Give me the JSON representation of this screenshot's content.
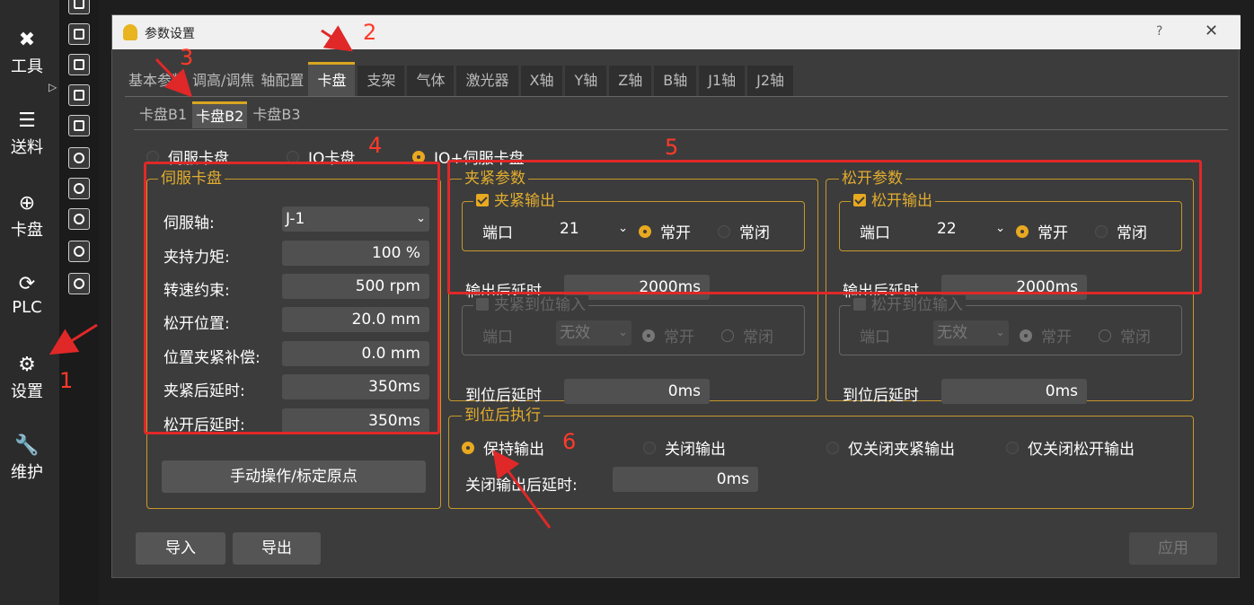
{
  "sidebar": {
    "items": [
      {
        "label": "工具",
        "icon": "tools-icon"
      },
      {
        "label": "送料",
        "icon": "feed-icon"
      },
      {
        "label": "卡盘",
        "icon": "chuck-icon"
      },
      {
        "label": "PLC",
        "icon": "plc-icon"
      },
      {
        "label": "设置",
        "icon": "gear-icon"
      },
      {
        "label": "维护",
        "icon": "wrench-icon"
      }
    ]
  },
  "dialog": {
    "title": "参数设置",
    "help": "?",
    "close": "✕"
  },
  "tabs": [
    "基本参数",
    "调高/调焦",
    "轴配置",
    "卡盘",
    "支架",
    "气体",
    "激光器",
    "X轴",
    "Y轴",
    "Z轴",
    "B轴",
    "J1轴",
    "J2轴"
  ],
  "subtabs": [
    "卡盘B1",
    "卡盘B2",
    "卡盘B3"
  ],
  "chuck_type": {
    "options": [
      "伺服卡盘",
      "IO卡盘",
      "IO+伺服卡盘"
    ],
    "selected": "IO+伺服卡盘"
  },
  "servo": {
    "title": "伺服卡盘",
    "axis_label": "伺服轴:",
    "axis_value": "J-1",
    "torque_label": "夹持力矩:",
    "torque_value": "100 %",
    "speed_label": "转速约束:",
    "speed_value": "500 rpm",
    "release_pos_label": "松开位置:",
    "release_pos_value": "20.0 mm",
    "comp_label": "位置夹紧补偿:",
    "comp_value": "0.0 mm",
    "clamp_delay_label": "夹紧后延时:",
    "clamp_delay_value": "350ms",
    "release_delay_label": "松开后延时:",
    "release_delay_value": "350ms",
    "manual_button": "手动操作/标定原点"
  },
  "clamp": {
    "title": "夹紧参数",
    "output_title": "夹紧输出",
    "port_label": "端口",
    "port_value": "21",
    "no": "常开",
    "nc": "常闭",
    "delay_label": "输出后延时",
    "delay_value": "2000ms",
    "input_title": "夹紧到位输入",
    "input_port_value": "无效",
    "arrive_delay_label": "到位后延时",
    "arrive_delay_value": "0ms"
  },
  "release": {
    "title": "松开参数",
    "output_title": "松开输出",
    "port_label": "端口",
    "port_value": "22",
    "no": "常开",
    "nc": "常闭",
    "delay_label": "输出后延时",
    "delay_value": "2000ms",
    "input_title": "松开到位输入",
    "input_port_value": "无效",
    "arrive_delay_label": "到位后延时",
    "arrive_delay_value": "0ms"
  },
  "after_arrive": {
    "title": "到位后执行",
    "options": [
      "保持输出",
      "关闭输出",
      "仅关闭夹紧输出",
      "仅关闭松开输出"
    ],
    "selected": "保持输出",
    "close_delay_label": "关闭输出后延时:",
    "close_delay_value": "0ms"
  },
  "footer": {
    "import": "导入",
    "export": "导出",
    "apply": "应用"
  },
  "annotations": [
    "1",
    "2",
    "3",
    "4",
    "5",
    "6"
  ],
  "colors": {
    "accent": "#e8a920",
    "annotation": "#e02828",
    "background": "#3c3c3c"
  }
}
